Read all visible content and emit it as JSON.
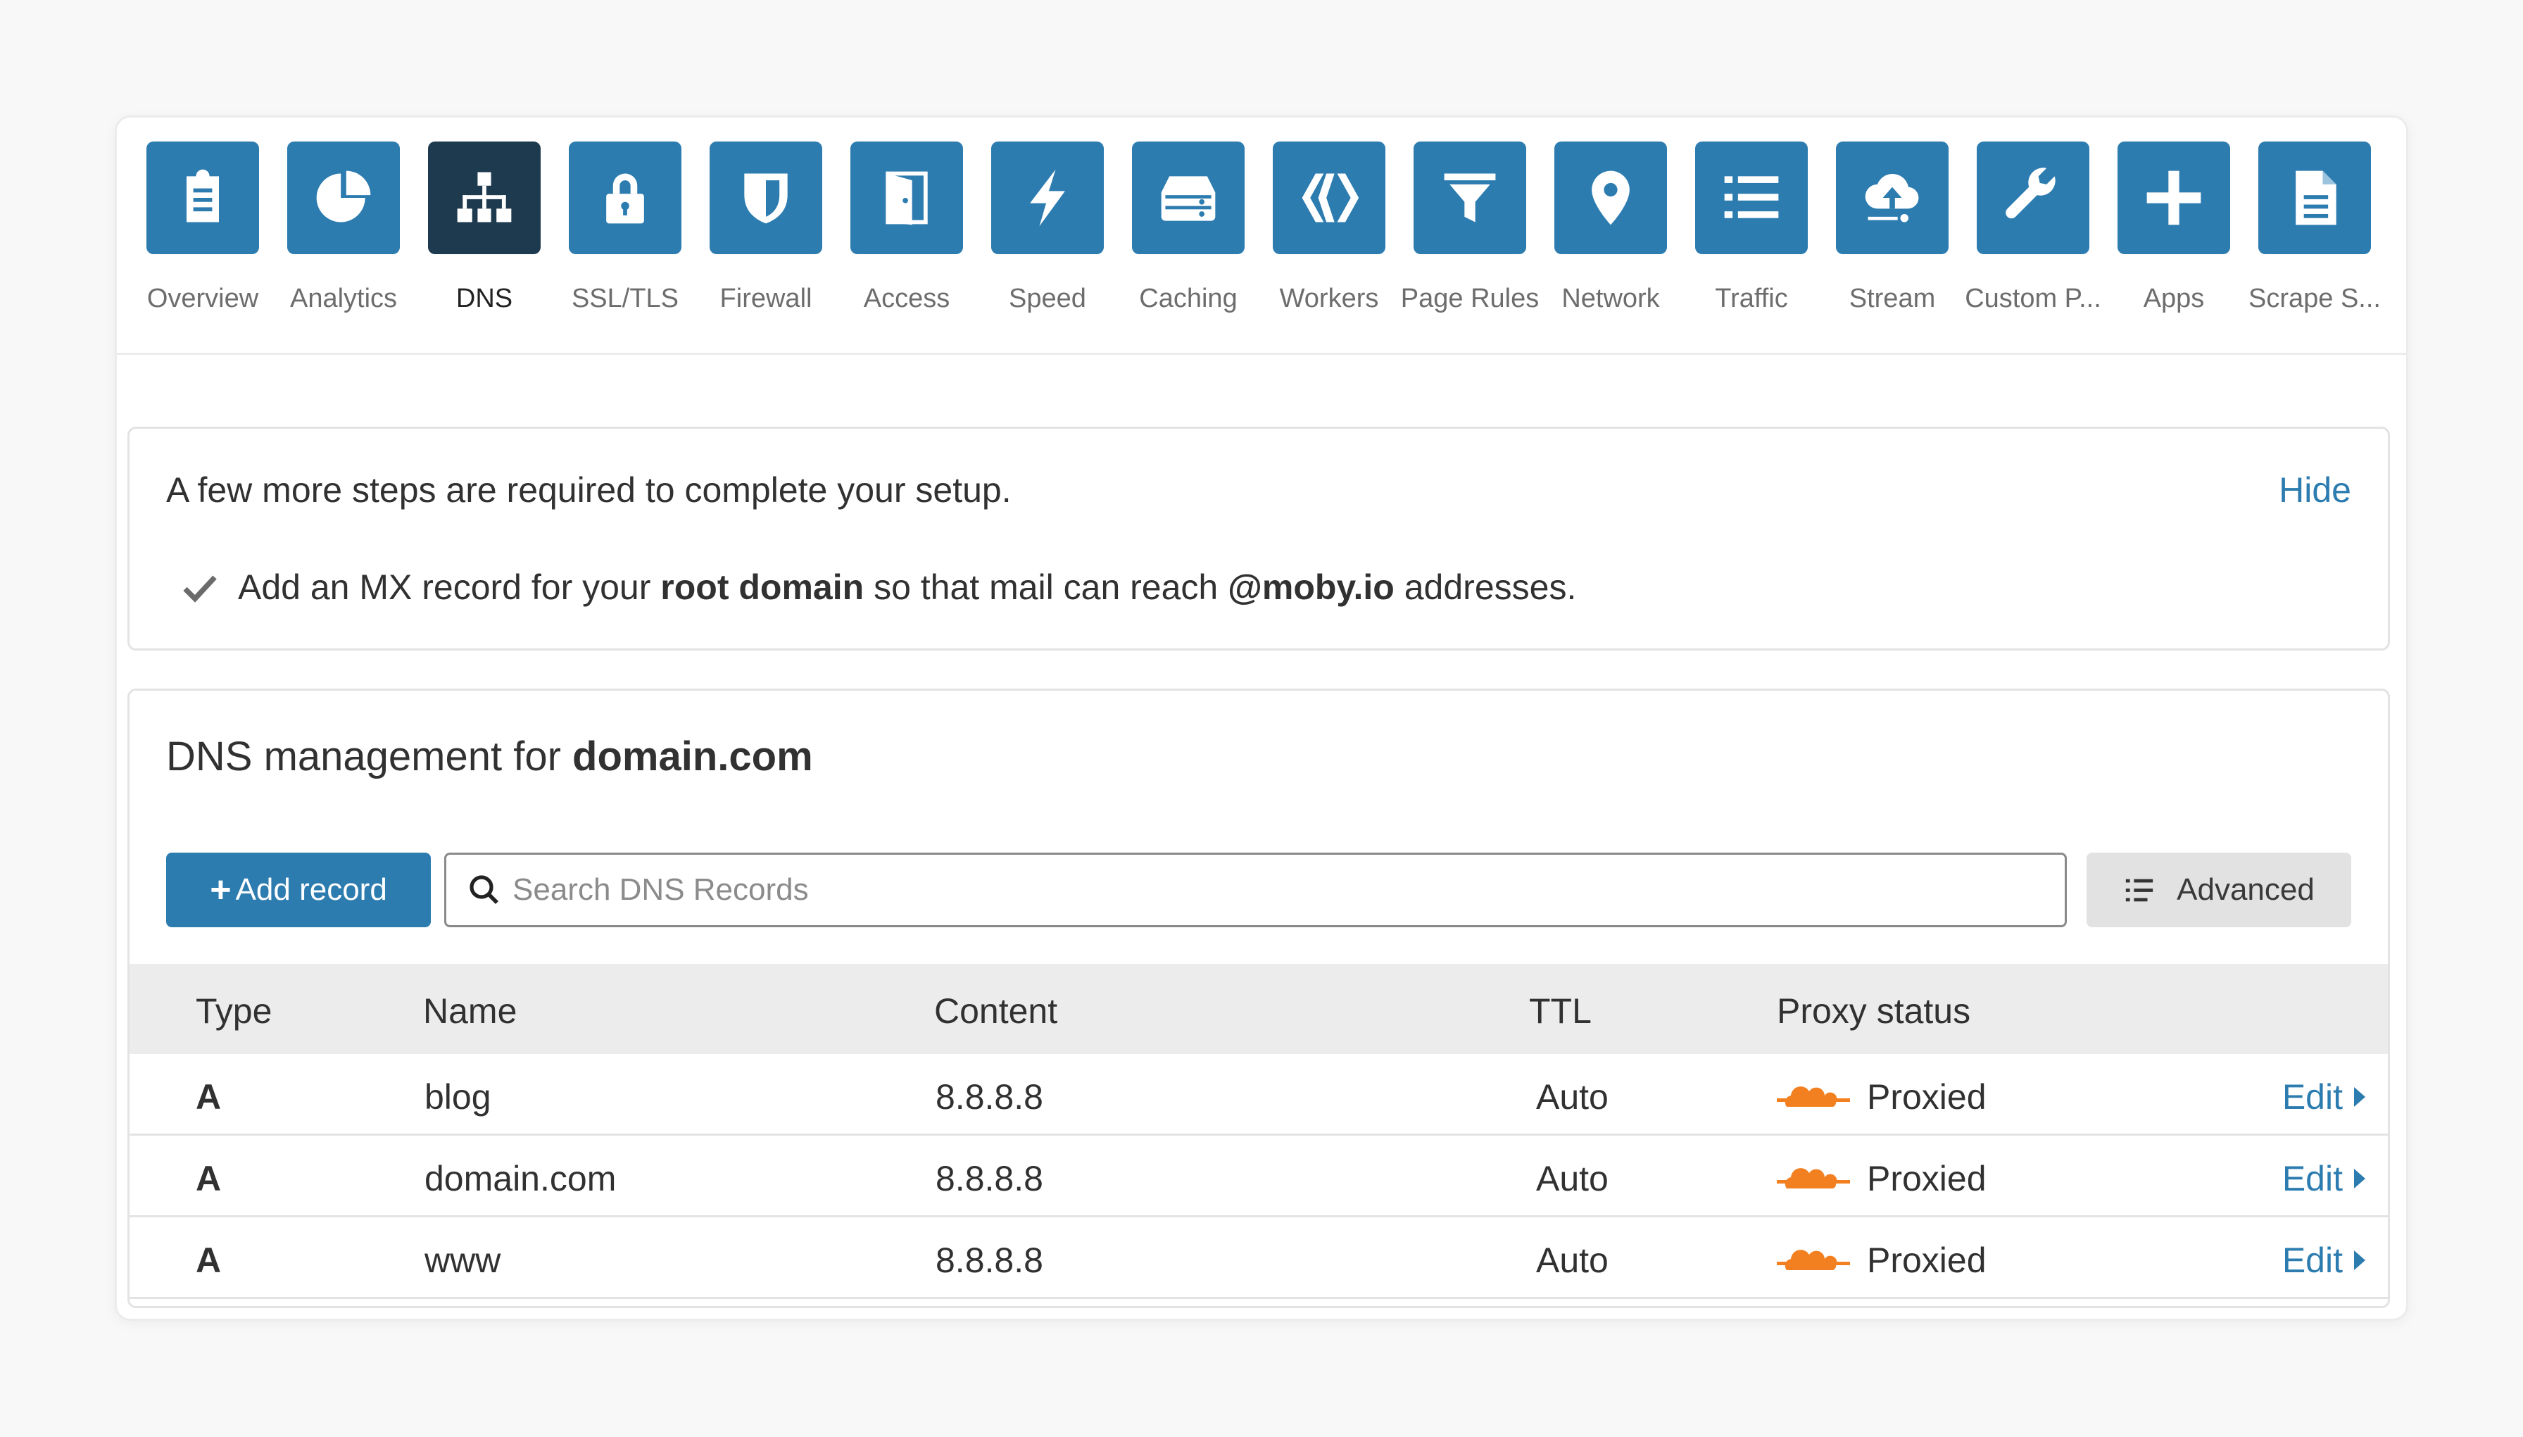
{
  "nav": {
    "items": [
      {
        "label": "Overview",
        "icon": "clipboard-icon"
      },
      {
        "label": "Analytics",
        "icon": "pie-chart-icon"
      },
      {
        "label": "DNS",
        "icon": "network-tree-icon",
        "active": true
      },
      {
        "label": "SSL/TLS",
        "icon": "lock-icon"
      },
      {
        "label": "Firewall",
        "icon": "shield-icon"
      },
      {
        "label": "Access",
        "icon": "door-icon"
      },
      {
        "label": "Speed",
        "icon": "lightning-icon"
      },
      {
        "label": "Caching",
        "icon": "server-icon"
      },
      {
        "label": "Workers",
        "icon": "workers-icon"
      },
      {
        "label": "Page Rules",
        "icon": "filter-icon"
      },
      {
        "label": "Network",
        "icon": "location-pin-icon"
      },
      {
        "label": "Traffic",
        "icon": "list-icon"
      },
      {
        "label": "Stream",
        "icon": "cloud-upload-icon"
      },
      {
        "label": "Custom P...",
        "icon": "wrench-icon"
      },
      {
        "label": "Apps",
        "icon": "plus-icon"
      },
      {
        "label": "Scrape S...",
        "icon": "document-icon"
      }
    ]
  },
  "setup": {
    "title": "A few more steps are required to complete your setup.",
    "hide_label": "Hide",
    "step": {
      "prefix": "Add an MX record for your",
      "bold1": "root domain",
      "middle": "so that mail can reach",
      "bold2": "@moby.io",
      "suffix": "addresses."
    }
  },
  "dns": {
    "title_prefix": "DNS management for",
    "domain": "domain.com",
    "add_record_label": "Add record",
    "search_placeholder": "Search DNS Records",
    "advanced_label": "Advanced",
    "columns": {
      "type": "Type",
      "name": "Name",
      "content": "Content",
      "ttl": "TTL",
      "proxy": "Proxy status"
    },
    "records": [
      {
        "type": "A",
        "name": "blog",
        "content": "8.8.8.8",
        "ttl": "Auto",
        "proxy": "Proxied",
        "edit": "Edit"
      },
      {
        "type": "A",
        "name": "domain.com",
        "content": "8.8.8.8",
        "ttl": "Auto",
        "proxy": "Proxied",
        "edit": "Edit"
      },
      {
        "type": "A",
        "name": "www",
        "content": "8.8.8.8",
        "ttl": "Auto",
        "proxy": "Proxied",
        "edit": "Edit"
      }
    ]
  },
  "colors": {
    "accent": "#2c7cb0",
    "active_tile": "#1e3a4f",
    "cloud": "#f38020",
    "table_header": "#ececec"
  }
}
